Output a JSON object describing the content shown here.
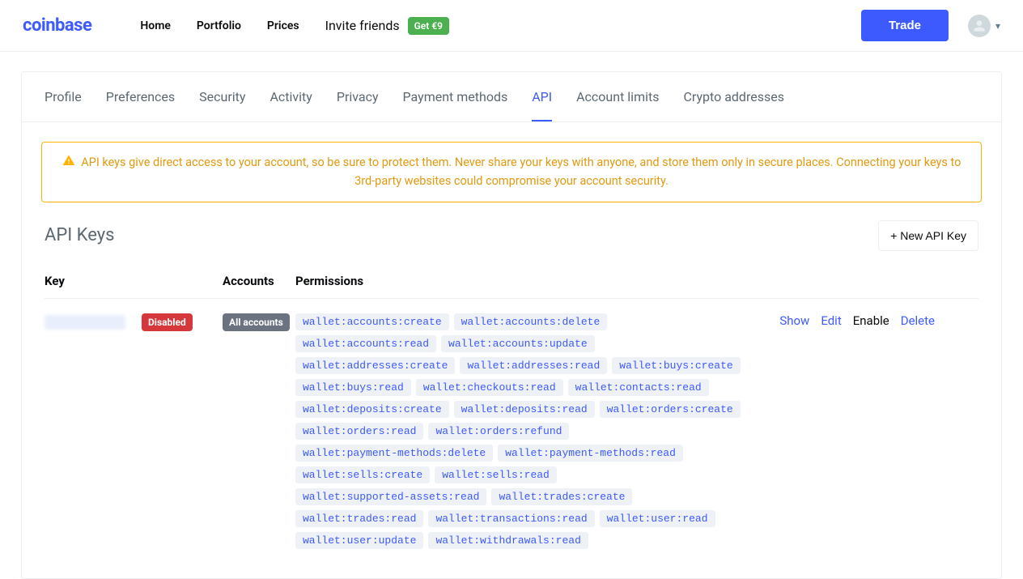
{
  "brand": "coinbase",
  "nav": {
    "home": "Home",
    "portfolio": "Portfolio",
    "prices": "Prices",
    "invite": "Invite friends",
    "get_badge": "Get €9"
  },
  "trade_label": "Trade",
  "tabs": {
    "profile": "Profile",
    "preferences": "Preferences",
    "security": "Security",
    "activity": "Activity",
    "privacy": "Privacy",
    "payment_methods": "Payment methods",
    "api": "API",
    "account_limits": "Account limits",
    "crypto_addresses": "Crypto addresses"
  },
  "alert_text": "API keys give direct access to your account, so be sure to protect them. Never share your keys with anyone, and store them only in secure places. Connecting your keys to 3rd-party websites could compromise your account security.",
  "section_title": "API Keys",
  "new_api_key_label": "+  New API Key",
  "table": {
    "headers": {
      "key": "Key",
      "accounts": "Accounts",
      "permissions": "Permissions"
    },
    "row": {
      "disabled_badge": "Disabled",
      "accounts_badge": "All accounts",
      "permissions": [
        "wallet:accounts:create",
        "wallet:accounts:delete",
        "wallet:accounts:read",
        "wallet:accounts:update",
        "wallet:addresses:create",
        "wallet:addresses:read",
        "wallet:buys:create",
        "wallet:buys:read",
        "wallet:checkouts:read",
        "wallet:contacts:read",
        "wallet:deposits:create",
        "wallet:deposits:read",
        "wallet:orders:create",
        "wallet:orders:read",
        "wallet:orders:refund",
        "wallet:payment-methods:delete",
        "wallet:payment-methods:read",
        "wallet:sells:create",
        "wallet:sells:read",
        "wallet:supported-assets:read",
        "wallet:trades:create",
        "wallet:trades:read",
        "wallet:transactions:read",
        "wallet:user:read",
        "wallet:user:update",
        "wallet:withdrawals:read"
      ],
      "actions": {
        "show": "Show",
        "edit": "Edit",
        "enable": "Enable",
        "delete": "Delete"
      }
    }
  }
}
